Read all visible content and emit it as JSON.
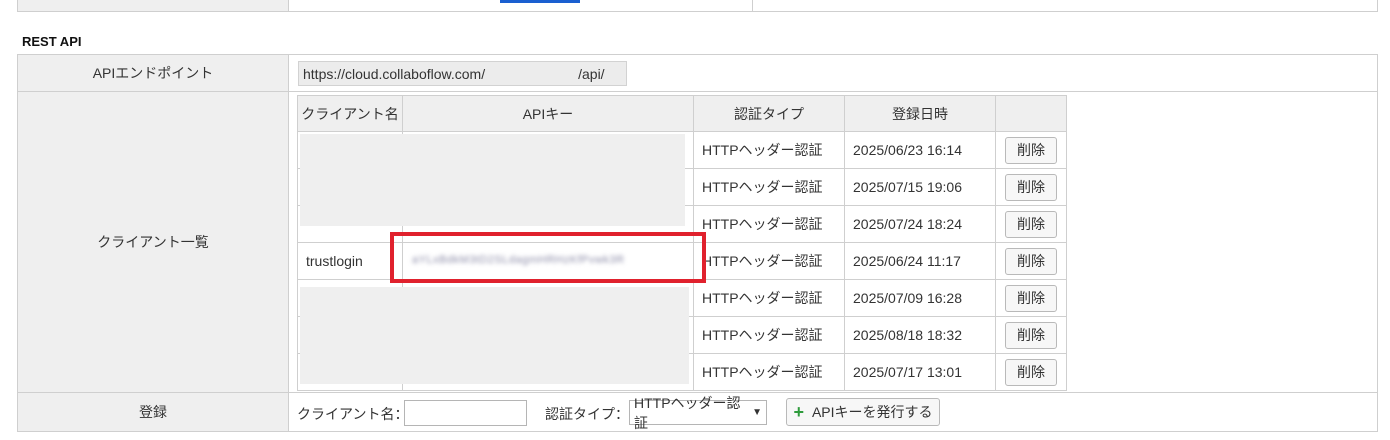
{
  "section_title": "REST API",
  "rows": {
    "endpoint_label": "APIエンドポイント",
    "client_list_label": "クライアント一覧",
    "register_label": "登録"
  },
  "endpoint": {
    "url_prefix": "https://cloud.collaboflow.com/",
    "url_suffix": "/api/"
  },
  "client_table": {
    "headers": [
      "クライアント名",
      "APIキー",
      "認証タイプ",
      "登録日時",
      ""
    ],
    "rows": [
      {
        "client_name": "",
        "auth_type": "HTTPヘッダー認証",
        "registered_at": "2025/06/23 16:14",
        "delete_label": "削除"
      },
      {
        "client_name": "",
        "auth_type": "HTTPヘッダー認証",
        "registered_at": "2025/07/15 19:06",
        "delete_label": "削除"
      },
      {
        "client_name": "",
        "auth_type": "HTTPヘッダー認証",
        "registered_at": "2025/07/24 18:24",
        "delete_label": "削除"
      },
      {
        "client_name": "trustlogin",
        "auth_type": "HTTPヘッダー認証",
        "registered_at": "2025/06/24 11:17",
        "delete_label": "削除"
      },
      {
        "client_name": "",
        "auth_type": "HTTPヘッダー認証",
        "registered_at": "2025/07/09 16:28",
        "delete_label": "削除"
      },
      {
        "client_name": "",
        "auth_type": "HTTPヘッダー認証",
        "registered_at": "2025/08/18 18:32",
        "delete_label": "削除"
      },
      {
        "client_name": "",
        "auth_type": "HTTPヘッダー認証",
        "registered_at": "2025/07/17 13:01",
        "delete_label": "削除"
      }
    ]
  },
  "register_form": {
    "client_name_label": "クライアント名：",
    "client_name_value": "",
    "auth_type_label": "認証タイプ：",
    "auth_type_selected": "HTTPヘッダー認証",
    "issue_button_label": "APIキーを発行する",
    "issue_button_icon": "plus-icon"
  },
  "colors": {
    "highlight": "#e0212d",
    "label_bg": "#efefef",
    "plus_icon": "#2e9b3c"
  }
}
